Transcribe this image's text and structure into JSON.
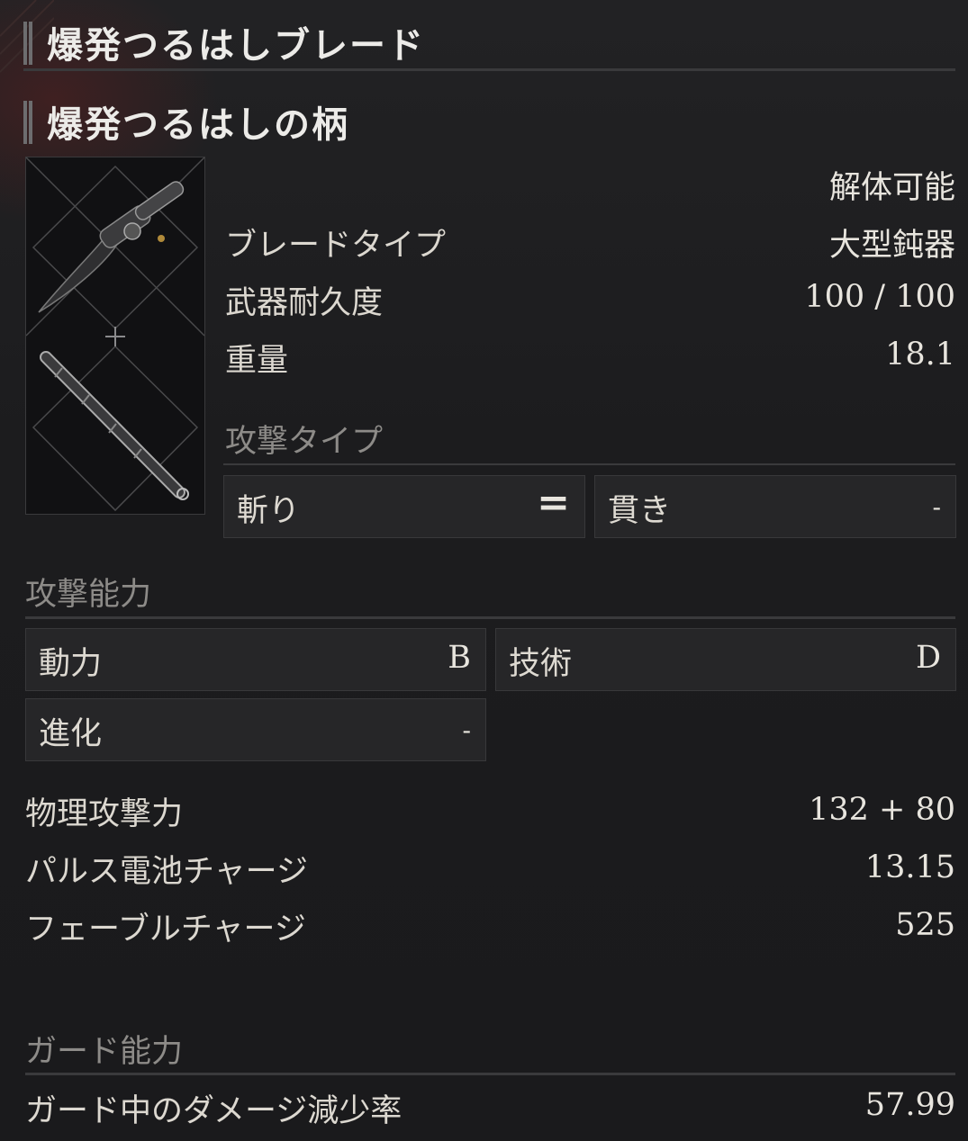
{
  "header": {
    "weapon_name": "爆発つるはしブレード",
    "part_name": "爆発つるはしの柄"
  },
  "info": {
    "disassemble": "解体可能",
    "blade_type_label": "ブレードタイプ",
    "blade_type_value": "大型鈍器",
    "durability_label": "武器耐久度",
    "durability_value": "100 / 100",
    "weight_label": "重量",
    "weight_value": "18.1",
    "attack_type_label": "攻撃タイプ"
  },
  "attack_types": [
    {
      "label": "斬り",
      "value": "="
    },
    {
      "label": "貫き",
      "value": "-"
    }
  ],
  "attack_ability": {
    "title": "攻撃能力",
    "stats": [
      {
        "label": "動力",
        "value": "B"
      },
      {
        "label": "技術",
        "value": "D"
      },
      {
        "label": "進化",
        "value": "-"
      }
    ]
  },
  "stats": [
    {
      "label": "物理攻撃力",
      "value": "132 + 80"
    },
    {
      "label": "パルス電池チャージ",
      "value": "13.15"
    },
    {
      "label": "フェーブルチャージ",
      "value": "525"
    }
  ],
  "guard_ability": {
    "title": "ガード能力",
    "damage_reduction_label": "ガード中のダメージ減少率",
    "damage_reduction_value": "57.99"
  },
  "colors": {
    "background": "#1b1b1d",
    "text": "#e4e1da",
    "muted": "#8d8b88",
    "box": "#262628",
    "accent_red": "#781e1e"
  }
}
